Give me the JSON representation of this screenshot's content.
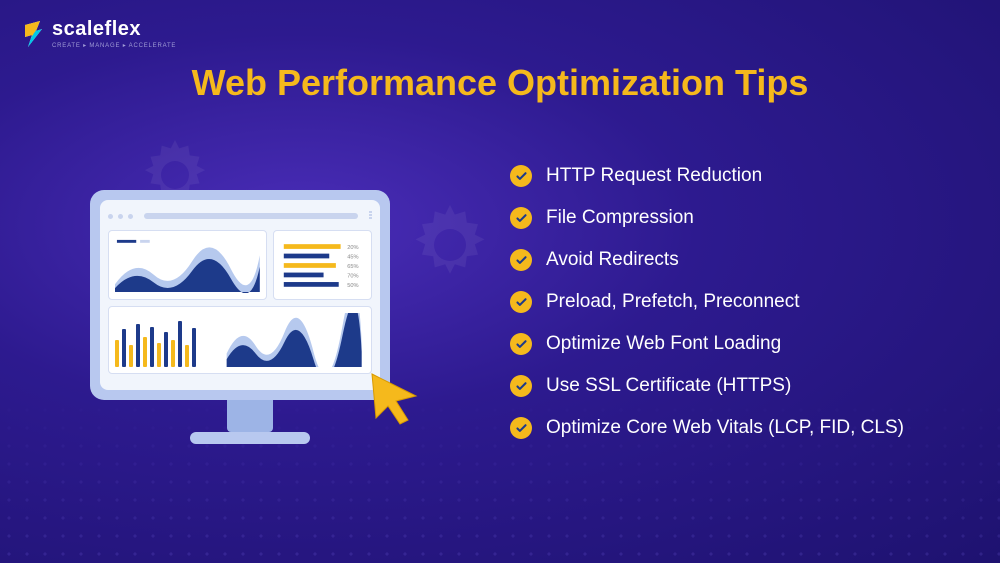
{
  "brand": {
    "name": "scaleflex",
    "tagline": "CREATE ▸ MANAGE ▸ ACCELERATE"
  },
  "title": "Web Performance Optimization Tips",
  "tips": [
    "HTTP Request Reduction",
    "File Compression",
    "Avoid Redirects",
    "Preload, Prefetch, Preconnect",
    "Optimize Web Font Loading",
    "Use SSL Certificate (HTTPS)",
    "Optimize Core Web Vitals (LCP, FID, CLS)"
  ],
  "colors": {
    "accent": "#f5b91c",
    "bg_start": "#4a2db8",
    "bg_end": "#1e1270",
    "navy": "#1d3a8a"
  }
}
